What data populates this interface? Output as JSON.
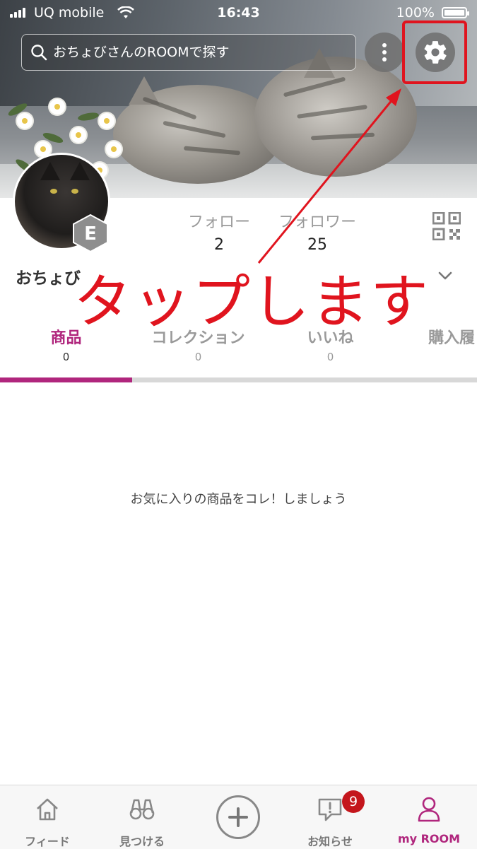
{
  "status_bar": {
    "carrier": "UQ mobile",
    "time": "16:43",
    "battery": "100%"
  },
  "search": {
    "placeholder": "おちょびさんのROOMで探す"
  },
  "profile": {
    "rank_letter": "E",
    "username": "おちょび",
    "follow": {
      "label": "フォロー",
      "count": "2"
    },
    "followers": {
      "label": "フォロワー",
      "count": "25"
    }
  },
  "annotation": {
    "text": "タップします",
    "color": "#e0141e"
  },
  "tabs": [
    {
      "label": "商品",
      "count": "0"
    },
    {
      "label": "コレクション",
      "count": "0"
    },
    {
      "label": "いいね",
      "count": "0"
    },
    {
      "label": "購入履",
      "count": ""
    }
  ],
  "empty_state": {
    "message": "お気に入りの商品をコレ！しましょう"
  },
  "bottom_nav": {
    "feed": "フィード",
    "discover": "見つける",
    "notifications": "お知らせ",
    "notification_count": "9",
    "my_room": "my ROOM"
  },
  "colors": {
    "accent": "#b0267d",
    "highlight": "#e0141e",
    "badge": "#c4161c"
  }
}
